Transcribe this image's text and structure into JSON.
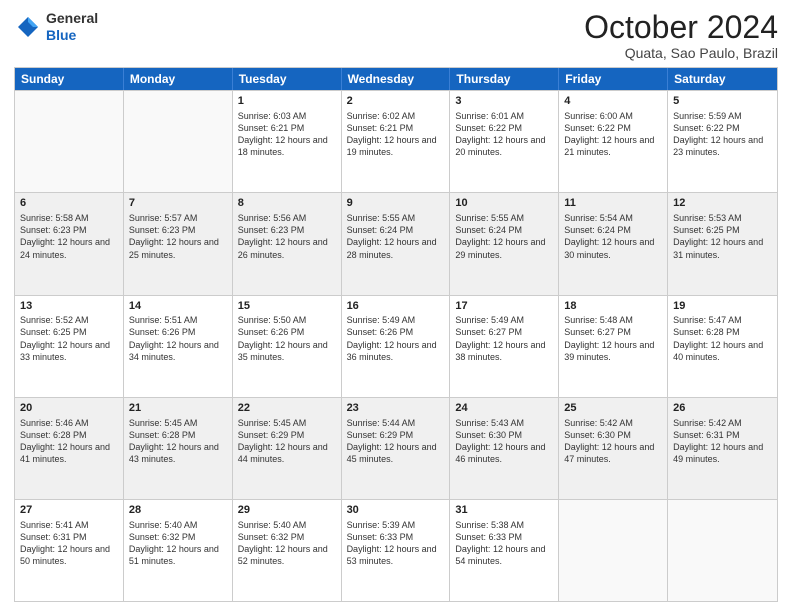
{
  "header": {
    "logo_general": "General",
    "logo_blue": "Blue",
    "month_title": "October 2024",
    "location": "Quata, Sao Paulo, Brazil"
  },
  "days_of_week": [
    "Sunday",
    "Monday",
    "Tuesday",
    "Wednesday",
    "Thursday",
    "Friday",
    "Saturday"
  ],
  "weeks": [
    [
      {
        "day": "",
        "sunrise": "",
        "sunset": "",
        "daylight": ""
      },
      {
        "day": "",
        "sunrise": "",
        "sunset": "",
        "daylight": ""
      },
      {
        "day": "1",
        "sunrise": "Sunrise: 6:03 AM",
        "sunset": "Sunset: 6:21 PM",
        "daylight": "Daylight: 12 hours and 18 minutes."
      },
      {
        "day": "2",
        "sunrise": "Sunrise: 6:02 AM",
        "sunset": "Sunset: 6:21 PM",
        "daylight": "Daylight: 12 hours and 19 minutes."
      },
      {
        "day": "3",
        "sunrise": "Sunrise: 6:01 AM",
        "sunset": "Sunset: 6:22 PM",
        "daylight": "Daylight: 12 hours and 20 minutes."
      },
      {
        "day": "4",
        "sunrise": "Sunrise: 6:00 AM",
        "sunset": "Sunset: 6:22 PM",
        "daylight": "Daylight: 12 hours and 21 minutes."
      },
      {
        "day": "5",
        "sunrise": "Sunrise: 5:59 AM",
        "sunset": "Sunset: 6:22 PM",
        "daylight": "Daylight: 12 hours and 23 minutes."
      }
    ],
    [
      {
        "day": "6",
        "sunrise": "Sunrise: 5:58 AM",
        "sunset": "Sunset: 6:23 PM",
        "daylight": "Daylight: 12 hours and 24 minutes."
      },
      {
        "day": "7",
        "sunrise": "Sunrise: 5:57 AM",
        "sunset": "Sunset: 6:23 PM",
        "daylight": "Daylight: 12 hours and 25 minutes."
      },
      {
        "day": "8",
        "sunrise": "Sunrise: 5:56 AM",
        "sunset": "Sunset: 6:23 PM",
        "daylight": "Daylight: 12 hours and 26 minutes."
      },
      {
        "day": "9",
        "sunrise": "Sunrise: 5:55 AM",
        "sunset": "Sunset: 6:24 PM",
        "daylight": "Daylight: 12 hours and 28 minutes."
      },
      {
        "day": "10",
        "sunrise": "Sunrise: 5:55 AM",
        "sunset": "Sunset: 6:24 PM",
        "daylight": "Daylight: 12 hours and 29 minutes."
      },
      {
        "day": "11",
        "sunrise": "Sunrise: 5:54 AM",
        "sunset": "Sunset: 6:24 PM",
        "daylight": "Daylight: 12 hours and 30 minutes."
      },
      {
        "day": "12",
        "sunrise": "Sunrise: 5:53 AM",
        "sunset": "Sunset: 6:25 PM",
        "daylight": "Daylight: 12 hours and 31 minutes."
      }
    ],
    [
      {
        "day": "13",
        "sunrise": "Sunrise: 5:52 AM",
        "sunset": "Sunset: 6:25 PM",
        "daylight": "Daylight: 12 hours and 33 minutes."
      },
      {
        "day": "14",
        "sunrise": "Sunrise: 5:51 AM",
        "sunset": "Sunset: 6:26 PM",
        "daylight": "Daylight: 12 hours and 34 minutes."
      },
      {
        "day": "15",
        "sunrise": "Sunrise: 5:50 AM",
        "sunset": "Sunset: 6:26 PM",
        "daylight": "Daylight: 12 hours and 35 minutes."
      },
      {
        "day": "16",
        "sunrise": "Sunrise: 5:49 AM",
        "sunset": "Sunset: 6:26 PM",
        "daylight": "Daylight: 12 hours and 36 minutes."
      },
      {
        "day": "17",
        "sunrise": "Sunrise: 5:49 AM",
        "sunset": "Sunset: 6:27 PM",
        "daylight": "Daylight: 12 hours and 38 minutes."
      },
      {
        "day": "18",
        "sunrise": "Sunrise: 5:48 AM",
        "sunset": "Sunset: 6:27 PM",
        "daylight": "Daylight: 12 hours and 39 minutes."
      },
      {
        "day": "19",
        "sunrise": "Sunrise: 5:47 AM",
        "sunset": "Sunset: 6:28 PM",
        "daylight": "Daylight: 12 hours and 40 minutes."
      }
    ],
    [
      {
        "day": "20",
        "sunrise": "Sunrise: 5:46 AM",
        "sunset": "Sunset: 6:28 PM",
        "daylight": "Daylight: 12 hours and 41 minutes."
      },
      {
        "day": "21",
        "sunrise": "Sunrise: 5:45 AM",
        "sunset": "Sunset: 6:28 PM",
        "daylight": "Daylight: 12 hours and 43 minutes."
      },
      {
        "day": "22",
        "sunrise": "Sunrise: 5:45 AM",
        "sunset": "Sunset: 6:29 PM",
        "daylight": "Daylight: 12 hours and 44 minutes."
      },
      {
        "day": "23",
        "sunrise": "Sunrise: 5:44 AM",
        "sunset": "Sunset: 6:29 PM",
        "daylight": "Daylight: 12 hours and 45 minutes."
      },
      {
        "day": "24",
        "sunrise": "Sunrise: 5:43 AM",
        "sunset": "Sunset: 6:30 PM",
        "daylight": "Daylight: 12 hours and 46 minutes."
      },
      {
        "day": "25",
        "sunrise": "Sunrise: 5:42 AM",
        "sunset": "Sunset: 6:30 PM",
        "daylight": "Daylight: 12 hours and 47 minutes."
      },
      {
        "day": "26",
        "sunrise": "Sunrise: 5:42 AM",
        "sunset": "Sunset: 6:31 PM",
        "daylight": "Daylight: 12 hours and 49 minutes."
      }
    ],
    [
      {
        "day": "27",
        "sunrise": "Sunrise: 5:41 AM",
        "sunset": "Sunset: 6:31 PM",
        "daylight": "Daylight: 12 hours and 50 minutes."
      },
      {
        "day": "28",
        "sunrise": "Sunrise: 5:40 AM",
        "sunset": "Sunset: 6:32 PM",
        "daylight": "Daylight: 12 hours and 51 minutes."
      },
      {
        "day": "29",
        "sunrise": "Sunrise: 5:40 AM",
        "sunset": "Sunset: 6:32 PM",
        "daylight": "Daylight: 12 hours and 52 minutes."
      },
      {
        "day": "30",
        "sunrise": "Sunrise: 5:39 AM",
        "sunset": "Sunset: 6:33 PM",
        "daylight": "Daylight: 12 hours and 53 minutes."
      },
      {
        "day": "31",
        "sunrise": "Sunrise: 5:38 AM",
        "sunset": "Sunset: 6:33 PM",
        "daylight": "Daylight: 12 hours and 54 minutes."
      },
      {
        "day": "",
        "sunrise": "",
        "sunset": "",
        "daylight": ""
      },
      {
        "day": "",
        "sunrise": "",
        "sunset": "",
        "daylight": ""
      }
    ]
  ]
}
